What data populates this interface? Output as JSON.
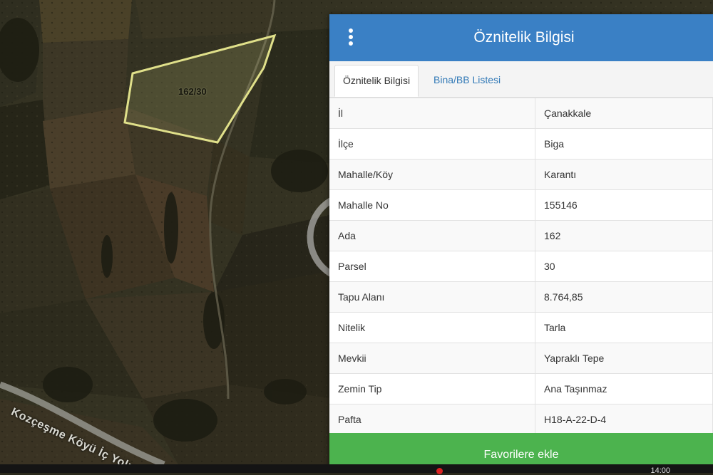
{
  "map": {
    "parcel_label": "162/30",
    "road_label": "Kozçeşme Köyü İç Yolu",
    "watermark_icon": "cb-star-logo-icon"
  },
  "panel": {
    "menu_icon": "vertical-dots-menu-icon",
    "title": "Öznitelik Bilgisi",
    "tabs": [
      {
        "label": "Öznitelik Bilgisi",
        "active": true
      },
      {
        "label": "Bina/BB Listesi",
        "active": false
      }
    ],
    "rows": [
      {
        "key": "İl",
        "value": "Çanakkale"
      },
      {
        "key": "İlçe",
        "value": "Biga"
      },
      {
        "key": "Mahalle/Köy",
        "value": "Karantı"
      },
      {
        "key": "Mahalle No",
        "value": "155146"
      },
      {
        "key": "Ada",
        "value": "162"
      },
      {
        "key": "Parsel",
        "value": "30"
      },
      {
        "key": "Tapu Alanı",
        "value": "8.764,85"
      },
      {
        "key": "Nitelik",
        "value": "Tarla"
      },
      {
        "key": "Mevkii",
        "value": "Yapraklı Tepe"
      },
      {
        "key": "Zemin Tip",
        "value": "Ana Taşınmaz"
      },
      {
        "key": "Pafta",
        "value": "H18-A-22-D-4"
      }
    ],
    "favorite_button": "Favorilere ekle"
  },
  "status_bar": {
    "clock": "14:00"
  },
  "colors": {
    "header": "#3a80c5",
    "button": "#4cb34e",
    "tab_link": "#337ab7",
    "parcel_outline": "#e0e08a"
  }
}
